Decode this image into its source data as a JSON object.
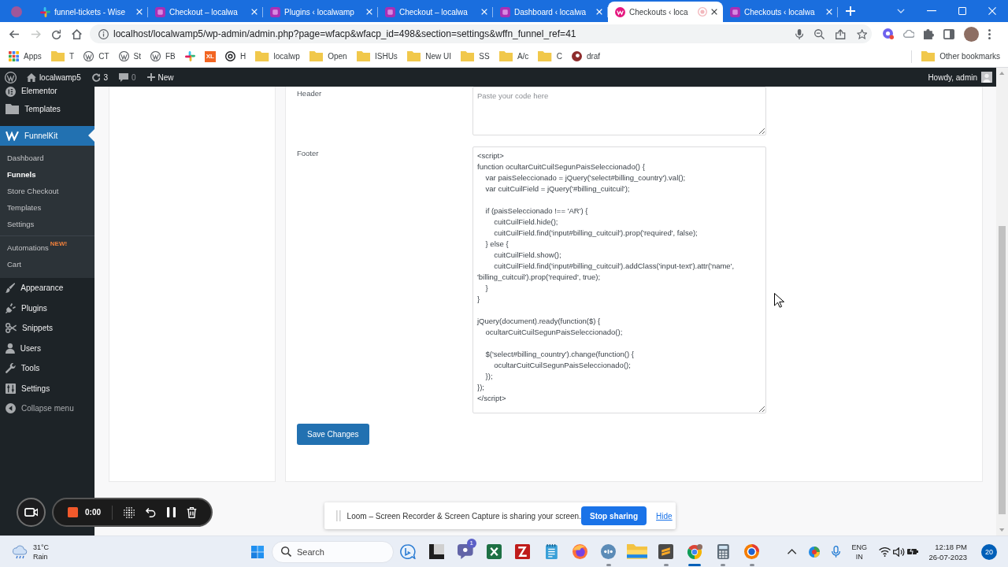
{
  "browser": {
    "tabs": [
      {
        "title": "funnel-tickets - Wise",
        "selected": false,
        "recording": false
      },
      {
        "title": "Checkout – localwa",
        "selected": false,
        "recording": false
      },
      {
        "title": "Plugins ‹ localwamp",
        "selected": false,
        "recording": false
      },
      {
        "title": "Checkout – localwa",
        "selected": false,
        "recording": false
      },
      {
        "title": "Dashboard ‹ localwa",
        "selected": false,
        "recording": false
      },
      {
        "title": "Checkouts ‹ loca",
        "selected": true,
        "recording": true
      },
      {
        "title": "Checkouts ‹ localwa",
        "selected": false,
        "recording": false
      }
    ],
    "url": "localhost/localwamp5/wp-admin/admin.php?page=wfacp&wfacp_id=498&section=settings&wffn_funnel_ref=41",
    "bookmarks": [
      {
        "kind": "apps",
        "label": "Apps"
      },
      {
        "kind": "folder",
        "label": "T"
      },
      {
        "kind": "wp",
        "label": "CT"
      },
      {
        "kind": "wp",
        "label": "St"
      },
      {
        "kind": "wp",
        "label": "FB"
      },
      {
        "kind": "slack"
      },
      {
        "kind": "tile",
        "label": "XL"
      },
      {
        "kind": "at",
        "label": "H"
      },
      {
        "kind": "folder",
        "label": "localwp"
      },
      {
        "kind": "folder",
        "label": "Open"
      },
      {
        "kind": "folder",
        "label": "ISHUs"
      },
      {
        "kind": "folder",
        "label": "New UI"
      },
      {
        "kind": "folder",
        "label": "SS"
      },
      {
        "kind": "folder",
        "label": "A/c"
      },
      {
        "kind": "folder",
        "label": "C"
      },
      {
        "kind": "site",
        "label": "draf"
      }
    ],
    "other_bookmarks": "Other bookmarks"
  },
  "admin_bar": {
    "site": "localwamp5",
    "updates": "3",
    "comments": "0",
    "new": "New",
    "greeting": "Howdy, admin"
  },
  "sidebar": {
    "menu": [
      {
        "label": "Elementor",
        "selected": false
      },
      {
        "label": "Templates",
        "selected": false
      },
      {
        "label": "FunnelKit",
        "selected": true,
        "submenu": [
          {
            "items": [
              {
                "label": "Dashboard",
                "selected": false
              },
              {
                "label": "Funnels",
                "selected": true
              },
              {
                "label": "Store Checkout",
                "selected": false
              },
              {
                "label": "Templates",
                "selected": false
              },
              {
                "label": "Settings",
                "selected": false
              }
            ]
          },
          {
            "items": [
              {
                "label": "Automations",
                "selected": false,
                "badge": "NEW!"
              },
              {
                "label": "Cart",
                "selected": false
              }
            ]
          }
        ]
      },
      {
        "label": "Appearance",
        "selected": false
      },
      {
        "label": "Plugins",
        "selected": false
      },
      {
        "label": "Snippets",
        "selected": false
      },
      {
        "label": "Users",
        "selected": false
      },
      {
        "label": "Tools",
        "selected": false
      },
      {
        "label": "Settings",
        "selected": false
      }
    ],
    "collapse": "Collapse menu"
  },
  "settings_form": {
    "fields": [
      {
        "label": "Header",
        "placeholder": "Paste your code here"
      },
      {
        "label": "Footer",
        "value": "<script>\nfunction ocultarCuitCuilSegunPaisSeleccionado() {\n    var paisSeleccionado = jQuery('select#billing_country').val();\n    var cuitCuilField = jQuery('#billing_cuitcuil');\n\n    if (paisSeleccionado !== 'AR') {\n        cuitCuilField.hide();\n        cuitCuilField.find('input#billing_cuitcuil').prop('required', false);\n    } else {\n        cuitCuilField.show();\n        cuitCuilField.find('input#billing_cuitcuil').addClass('input-text').attr('name', 'billing_cuitcuil').prop('required', true);\n    }\n}\n\njQuery(document).ready(function($) {\n    ocultarCuitCuilSegunPaisSeleccionado();\n\n    $('select#billing_country').change(function() {\n        ocultarCuitCuilSegunPaisSeleccionado();\n    });\n});\n</script>"
      }
    ],
    "save_button": "Save Changes"
  },
  "recorder": {
    "time": "0:00"
  },
  "sharing_bar": {
    "message": "Loom – Screen Recorder & Screen Capture is sharing your screen.",
    "stop_button": "Stop sharing",
    "hide_link": "Hide"
  },
  "taskbar": {
    "weather": {
      "temperature": "31°C",
      "condition": "Rain"
    },
    "search": {
      "placeholder": "Search"
    },
    "apps": [
      {
        "open": false,
        "selected": false
      },
      {
        "open": false,
        "selected": false
      },
      {
        "open": false,
        "selected": false,
        "badge": "1"
      },
      {
        "open": false,
        "selected": false
      },
      {
        "open": false,
        "selected": false
      },
      {
        "open": false,
        "selected": false
      },
      {
        "open": false,
        "selected": false
      },
      {
        "open": true,
        "selected": false
      },
      {
        "open": false,
        "selected": false
      },
      {
        "open": true,
        "selected": false
      },
      {
        "open": true,
        "selected": true
      },
      {
        "open": true,
        "selected": false
      },
      {
        "open": true,
        "selected": false
      }
    ],
    "language": "ENG",
    "region": "IN",
    "time": "12:18 PM",
    "date": "26-07-2023",
    "notifications": "20"
  }
}
